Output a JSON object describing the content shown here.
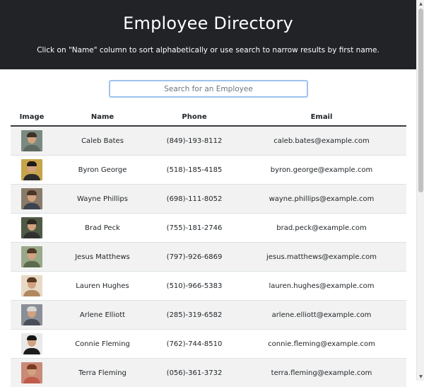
{
  "header": {
    "title": "Employee Directory",
    "subtitle": "Click on \"Name\" column to sort alphabetically or use search to narrow results by first name."
  },
  "search": {
    "placeholder": "Search for an Employee",
    "value": ""
  },
  "table": {
    "columns": [
      "Image",
      "Name",
      "Phone",
      "Email"
    ],
    "rows": [
      {
        "name": "Caleb Bates",
        "phone": "(849)-193-8112",
        "email": "caleb.bates@example.com",
        "bg": "#7a8a80",
        "hair": "#3b3128",
        "shirt": "#5e6a62"
      },
      {
        "name": "Byron George",
        "phone": "(518)-185-4185",
        "email": "byron.george@example.com",
        "bg": "#c6a44a",
        "hair": "#1e1a16",
        "shirt": "#2c2c2c"
      },
      {
        "name": "Wayne Phillips",
        "phone": "(698)-111-8052",
        "email": "wayne.phillips@example.com",
        "bg": "#8a7a6a",
        "hair": "#4a3526",
        "shirt": "#3c4450"
      },
      {
        "name": "Brad Peck",
        "phone": "(755)-181-2746",
        "email": "brad.peck@example.com",
        "bg": "#4f5a45",
        "hair": "#2e2a22",
        "shirt": "#303030"
      },
      {
        "name": "Jesus Matthews",
        "phone": "(797)-926-6869",
        "email": "jesus.matthews@example.com",
        "bg": "#9aa88a",
        "hair": "#4e3a26",
        "shirt": "#5d6b4c"
      },
      {
        "name": "Lauren Hughes",
        "phone": "(510)-966-5383",
        "email": "lauren.hughes@example.com",
        "bg": "#e8d9c6",
        "hair": "#5a3a20",
        "shirt": "#b08860"
      },
      {
        "name": "Arlene Elliott",
        "phone": "(285)-319-6582",
        "email": "arlene.elliott@example.com",
        "bg": "#8a8e96",
        "hair": "#d9d6d6",
        "shirt": "#4a4e58"
      },
      {
        "name": "Connie Fleming",
        "phone": "(762)-744-8510",
        "email": "connie.fleming@example.com",
        "bg": "#e9e9e9",
        "hair": "#141414",
        "shirt": "#1d1d1d"
      },
      {
        "name": "Terra Fleming",
        "phone": "(056)-361-3732",
        "email": "terra.fleming@example.com",
        "bg": "#c98a78",
        "hair": "#7a3a22",
        "shirt": "#c05a4a"
      }
    ]
  },
  "colors": {
    "header_bg": "#212327",
    "search_border": "#9ec3ef",
    "row_stripe": "#f2f2f2"
  },
  "icons": {
    "scroll_up": "scroll-up-arrow-icon",
    "scroll_down": "scroll-down-arrow-icon"
  }
}
